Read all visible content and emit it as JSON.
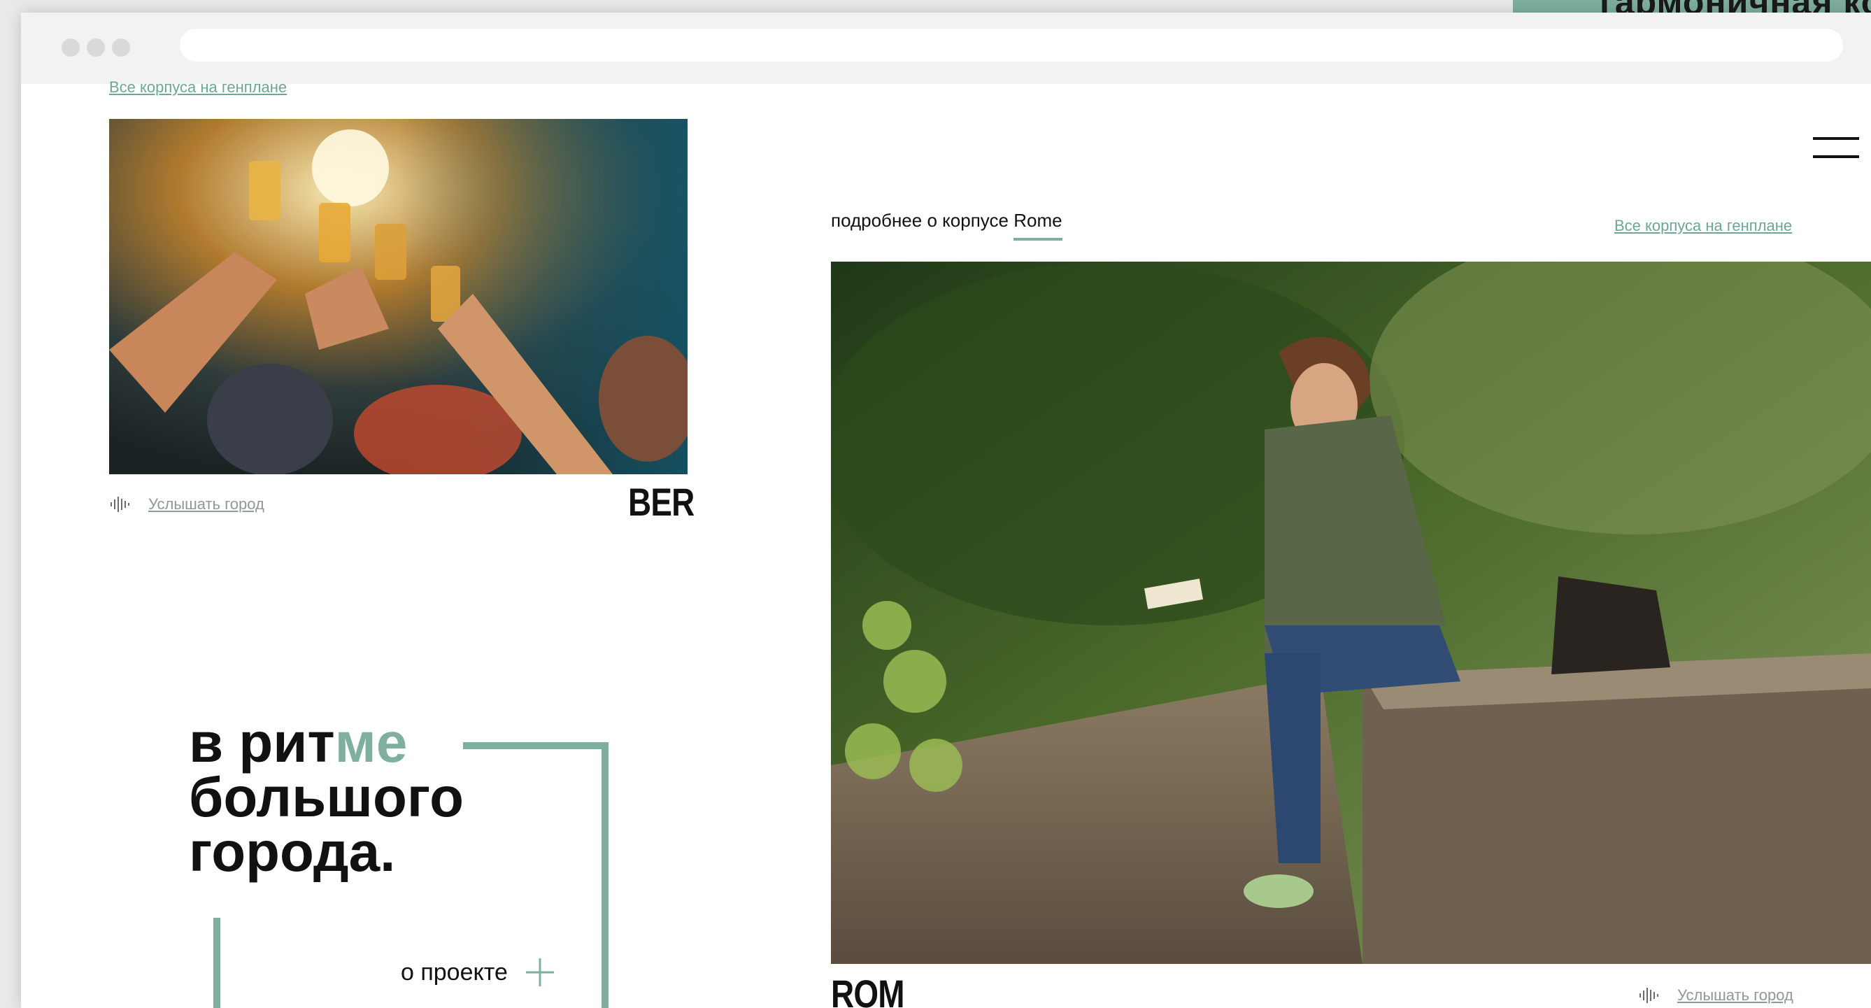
{
  "behind_window": {
    "peek_text": "гармоничная ком"
  },
  "colors": {
    "accent": "#7fb09d",
    "link": "#6aa892",
    "text": "#111111"
  },
  "top_link": "Все корпуса на генплане",
  "ber_card": {
    "listen_label": "Услышать город",
    "code": "BER",
    "icon": "sound-wave-icon"
  },
  "rome_section": {
    "label_prefix": "подробнее о корпусе ",
    "label_accent": "Rome",
    "plan_link": "Все корпуса на генплане",
    "code": "ROM",
    "listen_label": "Услышать город",
    "icon": "sound-wave-icon"
  },
  "slogan": {
    "line1_a": "в рит",
    "line1_b": "ме",
    "line2": "большого",
    "line3": "города."
  },
  "about_button": {
    "label": "о проекте",
    "icon": "plus-icon"
  },
  "menu": {
    "icon": "hamburger-menu-icon"
  }
}
